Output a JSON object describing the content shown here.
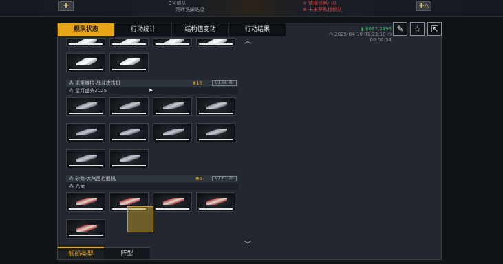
{
  "topbar": {
    "left_button_icon": "plus-icon",
    "right_button_icon": "plus-mountain-icon",
    "line1": "3号舰队",
    "line2": "河畔洗脚站吸",
    "right_line1": "情报侦察小队",
    "right_line2": "卡米罗私掠舰队"
  },
  "tabs": [
    {
      "label": "舰队状态",
      "active": true
    },
    {
      "label": "行动统计",
      "active": false
    },
    {
      "label": "结构值变动",
      "active": false
    },
    {
      "label": "行动结果",
      "active": false
    }
  ],
  "info": {
    "count": "6087.2496",
    "datetime": "2025-04-10 01:23:10",
    "duration": "00:00:54"
  },
  "header_buttons": [
    {
      "icon": "report-icon"
    },
    {
      "icon": "star-icon"
    },
    {
      "icon": "export-icon"
    }
  ],
  "sections": [
    {
      "title": "米斯特拉-战斗攻击机",
      "badge": "10",
      "tag": "V1.56-40",
      "sub": "星灯盛典2025"
    },
    {
      "title": "矽龙-大气层拦截机",
      "badge": "5",
      "tag": "V1.67-20",
      "sub": "光荣"
    }
  ],
  "bottom_tabs": [
    {
      "label": "舰船类型",
      "active": true
    },
    {
      "label": "阵型",
      "active": false
    }
  ]
}
